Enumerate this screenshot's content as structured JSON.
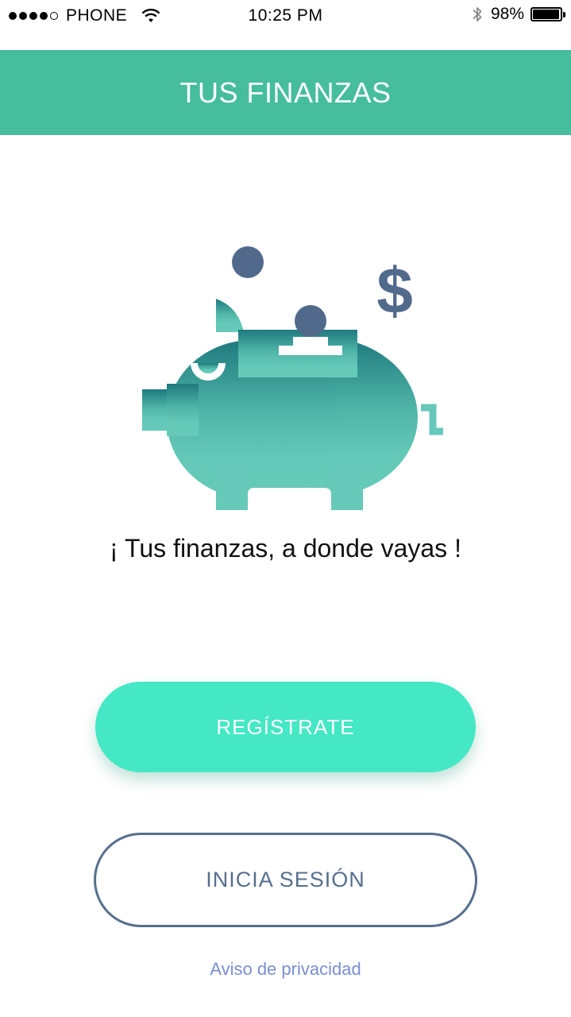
{
  "status_bar": {
    "carrier": "PHONE",
    "time": "10:25 PM",
    "battery_percent": "98%",
    "battery_level": 0.98,
    "signal_bars_filled": 4,
    "signal_bars_total": 5
  },
  "header": {
    "title": "TUS FINANZAS"
  },
  "hero": {
    "tagline": "¡ Tus finanzas, a donde vayas !"
  },
  "actions": {
    "register_label": "REGÍSTRATE",
    "login_label": "INICIA SESIÓN",
    "privacy_label": "Aviso de privacidad"
  },
  "colors": {
    "header_bg": "#46bd9d",
    "register_bg": "#44e8c4",
    "login_border": "#566f8e",
    "coin": "#516a8c",
    "pig_top": "#1f7a7f",
    "pig_bottom": "#64c9b8",
    "link": "#7a8fd4"
  },
  "icons": {
    "wifi": "wifi-icon",
    "bluetooth": "bluetooth-icon",
    "battery": "battery-icon",
    "piggy_bank": "piggy-bank-icon",
    "coin": "coin-icon",
    "dollar": "dollar-sign-icon"
  }
}
